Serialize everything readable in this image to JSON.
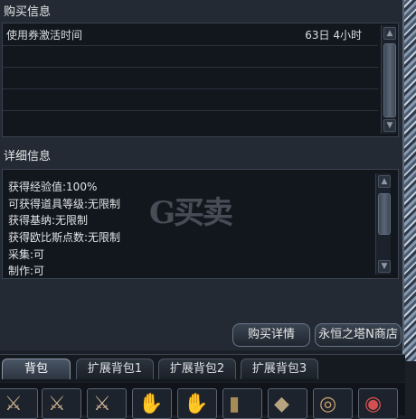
{
  "purchase_info": {
    "title": "购买信息",
    "rows": [
      {
        "label": "使用券激活时间",
        "value": "63日 4小时"
      }
    ]
  },
  "details": {
    "title": "详细信息",
    "lines": [
      "获得经验值:100%",
      "可获得道具等级:无限制",
      "获得基纳:无限制",
      "获得欧比斯点数:无限制",
      "采集:可",
      "制作:可"
    ]
  },
  "watermark": "G买卖",
  "buttons": {
    "detail": "购买详情",
    "store": "永恒之塔N商店"
  },
  "tabs": [
    "背包",
    "扩展背包1",
    "扩展背包2",
    "扩展背包3"
  ],
  "active_tab": "背包",
  "inventory_icons": [
    "sword-icon",
    "sword-icon",
    "sword-icon",
    "gauntlet-icon",
    "gauntlet-icon",
    "boots-icon",
    "armor-icon",
    "ring-icon",
    "ring-icon"
  ]
}
